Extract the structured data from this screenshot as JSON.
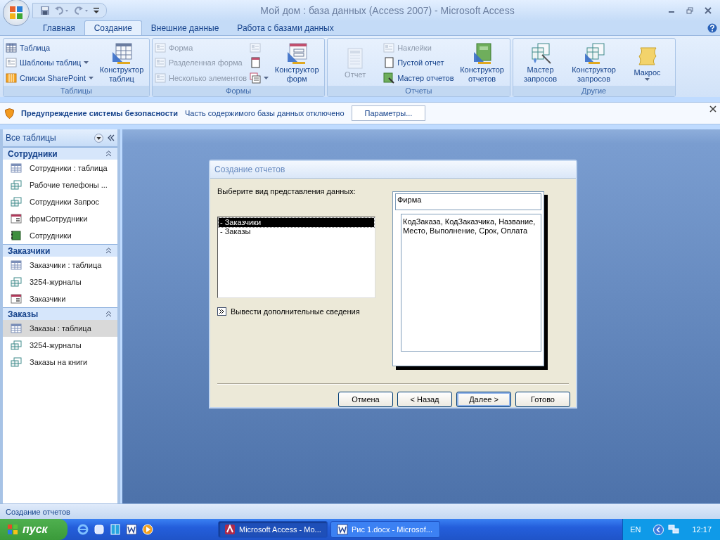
{
  "window": {
    "title": "Мой дом : база данных (Access 2007) - Microsoft Access"
  },
  "tabs": [
    {
      "label": "Главная",
      "selected": false
    },
    {
      "label": "Создание",
      "selected": true
    },
    {
      "label": "Внешние данные",
      "selected": false
    },
    {
      "label": "Работа с базами данных",
      "selected": false
    }
  ],
  "ribbon": {
    "groups": [
      {
        "label": "Таблицы",
        "columns": [
          [
            {
              "label": "Таблица",
              "kind": "table",
              "disabled": false,
              "dropdown": false
            },
            {
              "label": "Шаблоны таблиц",
              "kind": "template",
              "disabled": false,
              "dropdown": true
            },
            {
              "label": "Списки SharePoint",
              "kind": "list",
              "disabled": false,
              "dropdown": true
            }
          ],
          [
            {
              "label": "Конструктор таблиц",
              "kind": "tabledesign",
              "disabled": false,
              "dropdown": false
            }
          ]
        ]
      },
      {
        "label": "Формы",
        "columns": [
          [
            {
              "label": "Форма",
              "kind": "form",
              "disabled": true,
              "dropdown": false
            },
            {
              "label": "Разделенная форма",
              "kind": "split",
              "disabled": true,
              "dropdown": false
            },
            {
              "label": "Несколько элементов",
              "kind": "multi",
              "disabled": true,
              "dropdown": false
            }
          ],
          [
            {
              "kind": "pivot",
              "disabled": true,
              "dropdown": false
            },
            {
              "kind": "blankform",
              "disabled": false,
              "dropdown": false
            },
            {
              "kind": "moreforms",
              "disabled": false,
              "dropdown": true
            }
          ],
          [
            {
              "label": "Конструктор форм",
              "kind": "formdesign",
              "disabled": false,
              "dropdown": false
            }
          ]
        ]
      },
      {
        "label": "Отчеты",
        "columns": [
          [
            {
              "label": "Отчет",
              "kind": "report",
              "disabled": true,
              "dropdown": false
            }
          ],
          [
            {
              "label": "Наклейки",
              "kind": "labels",
              "disabled": true,
              "dropdown": false
            },
            {
              "label": "Пустой отчет",
              "kind": "blankreport",
              "disabled": false,
              "dropdown": false
            },
            {
              "label": "Мастер отчетов",
              "kind": "reportwizard",
              "disabled": false,
              "dropdown": false
            }
          ],
          [
            {
              "label": "Конструктор отчетов",
              "kind": "reportdesign",
              "disabled": false,
              "dropdown": false
            }
          ]
        ]
      },
      {
        "label": "Другие",
        "columns": [
          [
            {
              "label": "Мастер запросов",
              "kind": "querywizard",
              "disabled": false,
              "dropdown": false
            }
          ],
          [
            {
              "label": "Конструктор запросов",
              "kind": "querydesign",
              "disabled": false,
              "dropdown": false
            }
          ],
          [
            {
              "label": "Макрос",
              "kind": "macro",
              "disabled": false,
              "dropdown": true
            }
          ]
        ]
      }
    ]
  },
  "security_bar": {
    "title": "Предупреждение системы безопасности",
    "message": "Часть содержимого базы данных отключено",
    "button": "Параметры..."
  },
  "navigation": {
    "header": "Все таблицы",
    "groups": [
      {
        "label": "Сотрудники",
        "expanded": true,
        "items": [
          {
            "label": "Сотрудники : таблица",
            "kind": "table",
            "selected": false
          },
          {
            "label": "Рабочие телефоны ...",
            "kind": "query",
            "selected": false
          },
          {
            "label": "Сотрудники Запрос",
            "kind": "query",
            "selected": false
          },
          {
            "label": "фрмСотрудники",
            "kind": "form",
            "selected": false
          },
          {
            "label": "Сотрудники",
            "kind": "report",
            "selected": false
          }
        ]
      },
      {
        "label": "Заказчики",
        "expanded": true,
        "items": [
          {
            "label": "Заказчики : таблица",
            "kind": "table",
            "selected": false
          },
          {
            "label": "3254-журналы",
            "kind": "query",
            "selected": false
          },
          {
            "label": "Заказчики",
            "kind": "form",
            "selected": false
          }
        ]
      },
      {
        "label": "Заказы",
        "expanded": true,
        "items": [
          {
            "label": "Заказы : таблица",
            "kind": "table",
            "selected": true
          },
          {
            "label": "3254-журналы",
            "kind": "query",
            "selected": false
          },
          {
            "label": "Заказы на книги",
            "kind": "query",
            "selected": false
          }
        ]
      }
    ]
  },
  "dialog": {
    "title": "Создание отчетов",
    "prompt": "Выберите вид представления данных:",
    "views": [
      {
        "label": "- Заказчики",
        "selected": true
      },
      {
        "label": "- Заказы",
        "selected": false
      }
    ],
    "more_info": "Вывести дополнительные сведения",
    "preview": {
      "header": "Фирма",
      "fields": "КодЗаказа, КодЗаказчика, Название, Место, Выполнение, Срок, Оплата"
    },
    "buttons": [
      {
        "label": "Отмена",
        "default": false
      },
      {
        "label": "< Назад",
        "default": false
      },
      {
        "label": "Далее >",
        "default": true
      },
      {
        "label": "Готово",
        "default": false
      }
    ]
  },
  "status_bar": {
    "text": "Создание отчетов"
  },
  "taskbar": {
    "start": "пуск",
    "tasks": [
      {
        "label": "Microsoft Access - Mo...",
        "selected": true,
        "kind": "access"
      },
      {
        "label": "Рис 1.docx - Microsof...",
        "selected": false,
        "kind": "word"
      }
    ],
    "language": "EN",
    "clock": "12:17"
  }
}
